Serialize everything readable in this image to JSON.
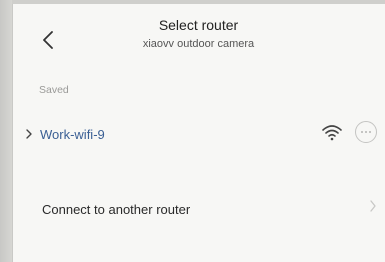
{
  "header": {
    "title": "Select router",
    "subtitle": "xiaovv outdoor camera",
    "back_icon": "chevron-left-icon"
  },
  "saved_section": {
    "label": "Saved",
    "routers": [
      {
        "name": "Work-wifi-9",
        "signal_icon": "wifi-icon",
        "more_icon": "more-icon"
      }
    ]
  },
  "connect_other": {
    "label": "Connect to another router",
    "icon": "chevron-right-icon"
  },
  "colors": {
    "router_name": "#3a5f94",
    "background": "#f7f7f5"
  }
}
